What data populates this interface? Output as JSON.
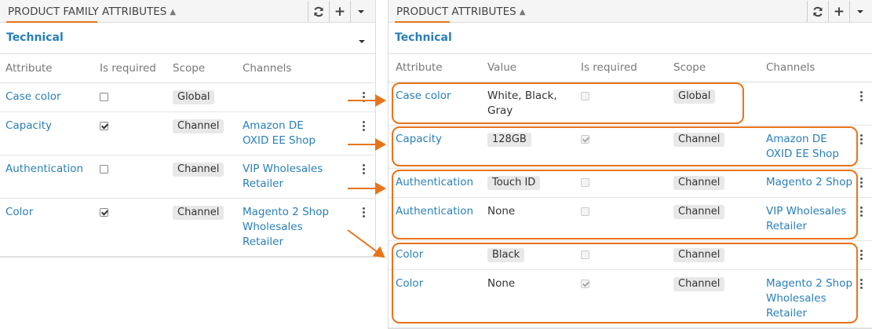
{
  "left": {
    "title": "PRODUCT FAMILY ATTRIBUTES",
    "section": "Technical",
    "columns": [
      "Attribute",
      "Is required",
      "Scope",
      "Channels"
    ],
    "rows": [
      {
        "attribute": "Case color",
        "required": false,
        "scope": "Global",
        "channels": []
      },
      {
        "attribute": "Capacity",
        "required": true,
        "scope": "Channel",
        "channels": [
          "Amazon DE",
          "OXID EE Shop"
        ]
      },
      {
        "attribute": "Authentication",
        "required": false,
        "scope": "Channel",
        "channels": [
          "VIP Wholesales",
          "Retailer"
        ]
      },
      {
        "attribute": "Color",
        "required": true,
        "scope": "Channel",
        "channels": [
          "Magento 2 Shop",
          "Wholesales",
          "Retailer"
        ]
      }
    ]
  },
  "right": {
    "title": "PRODUCT ATTRIBUTES",
    "section": "Technical",
    "columns": [
      "Attribute",
      "Value",
      "Is required",
      "Scope",
      "Channels"
    ],
    "rows": [
      {
        "attribute": "Case color",
        "value": [
          "White, Black,",
          "Gray"
        ],
        "value_badge": false,
        "required": false,
        "scope": "Global",
        "channels": []
      },
      {
        "attribute": "Capacity",
        "value": [
          "128GB"
        ],
        "value_badge": true,
        "required": true,
        "scope": "Channel",
        "channels": [
          "Amazon DE",
          "OXID EE Shop"
        ]
      },
      {
        "attribute": "Authentication",
        "value": [
          "Touch ID"
        ],
        "value_badge": true,
        "required": false,
        "scope": "Channel",
        "channels": [
          "Magento 2 Shop"
        ]
      },
      {
        "attribute": "Authentication",
        "value": [
          "None"
        ],
        "value_badge": false,
        "required": false,
        "scope": "Channel",
        "channels": [
          "VIP Wholesales",
          "Retailer"
        ]
      },
      {
        "attribute": "Color",
        "value": [
          "Black"
        ],
        "value_badge": true,
        "required": false,
        "scope": "Channel",
        "channels": []
      },
      {
        "attribute": "Color",
        "value": [
          "None"
        ],
        "value_badge": false,
        "required": true,
        "scope": "Channel",
        "channels": [
          "Magento 2 Shop",
          "Wholesales",
          "Retailer"
        ]
      }
    ]
  },
  "toolbar_icons": [
    "refresh-icon",
    "plus-icon",
    "caret-down-icon"
  ],
  "colors": {
    "accent": "#e8741a",
    "link": "#2a7fb8"
  }
}
